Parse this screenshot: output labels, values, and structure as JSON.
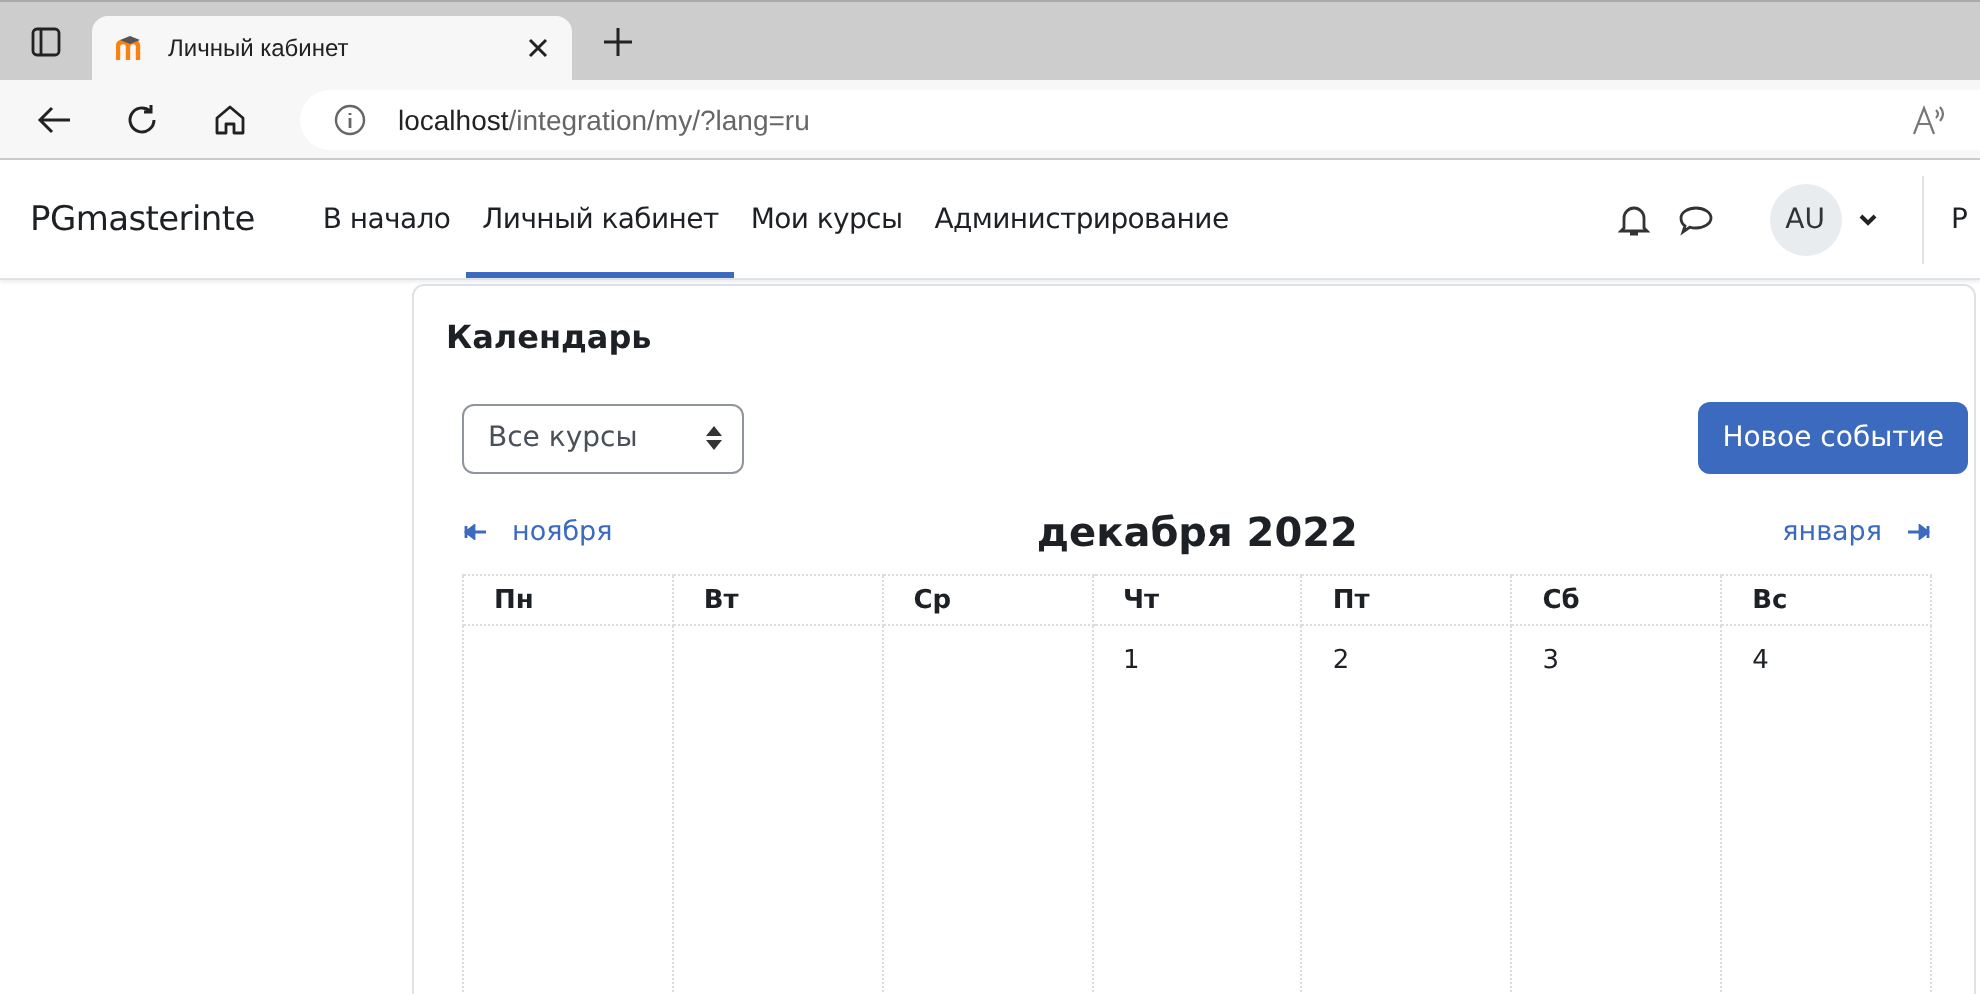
{
  "browser": {
    "tabs": [
      {
        "title": "Личный кабинет",
        "selected": true
      }
    ],
    "url": {
      "host": "localhost",
      "path": "/integration/my/?lang=ru"
    }
  },
  "navbar": {
    "brand": "PGmasterinte",
    "items": [
      {
        "label": "В начало",
        "selected": false
      },
      {
        "label": "Личный кабинет",
        "selected": true
      },
      {
        "label": "Мои курсы",
        "selected": false
      },
      {
        "label": "Администрирование",
        "selected": false
      }
    ],
    "avatar": "AU",
    "edit_mode_label": "Р"
  },
  "calendar": {
    "title": "Календарь",
    "course_filter": "Все курсы",
    "new_event_button": "Новое событие",
    "prev_month": "ноября",
    "current_month": "декабря 2022",
    "next_month": "января",
    "weekdays": [
      "Пн",
      "Вт",
      "Ср",
      "Чт",
      "Пт",
      "Сб",
      "Вс"
    ],
    "weeks": [
      [
        {
          "kind": "empty"
        },
        {
          "kind": "empty"
        },
        {
          "kind": "empty"
        },
        {
          "kind": "day",
          "day": "1"
        },
        {
          "kind": "day",
          "day": "2"
        },
        {
          "kind": "day",
          "day": "3"
        },
        {
          "kind": "day",
          "day": "4"
        }
      ]
    ]
  }
}
